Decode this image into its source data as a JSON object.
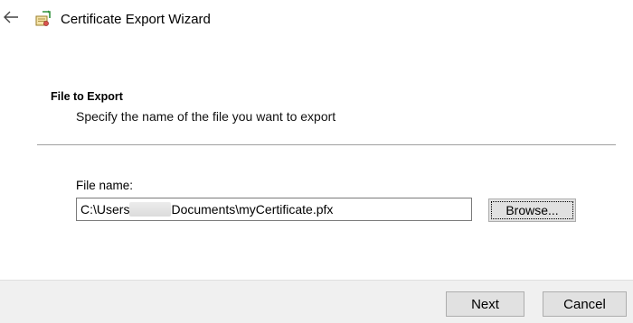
{
  "window": {
    "title": "Certificate Export Wizard",
    "icons": {
      "back": "back-arrow-icon",
      "app": "certificate-wizard-icon"
    }
  },
  "section": {
    "heading": "File to Export",
    "description": "Specify the name of the file you want to export"
  },
  "file": {
    "label": "File name:",
    "value_prefix": "C:\\Users",
    "value_suffix": "Documents\\myCertificate.pfx",
    "browse_label": "Browse..."
  },
  "footer": {
    "next_label": "Next",
    "cancel_label": "Cancel"
  },
  "colors": {
    "background": "#ffffff",
    "footer_background": "#f0f0f0",
    "button_face": "#e1e1e1",
    "button_border": "#adadad",
    "divider": "#a0a0a0"
  }
}
